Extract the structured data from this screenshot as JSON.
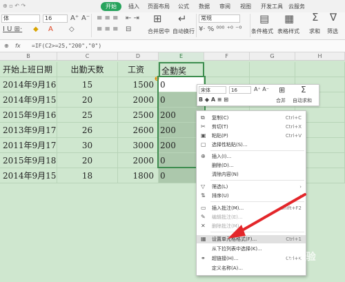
{
  "ribbon": {
    "tabs": [
      "开始",
      "插入",
      "页面布局",
      "公式",
      "数据",
      "审阅",
      "视图",
      "开发工具",
      "云服务"
    ],
    "font_name": "体",
    "font_size": "16",
    "number_format": "常规",
    "merge_center": "合并居中",
    "auto_wrap": "自动换行",
    "conditional_format": "条件格式",
    "table_style": "表格样式",
    "sum": "求和",
    "filter": "筛选"
  },
  "formula_bar": {
    "fx": "fx",
    "formula": "=IF(C2>=25,\"200\",\"0\")"
  },
  "columns": [
    "B",
    "C",
    "D",
    "E",
    "F",
    "G",
    "H"
  ],
  "table": {
    "headers": [
      "开始上班日期",
      "出勤天数",
      "工资",
      "全勤奖"
    ],
    "rows": [
      [
        "2014年9月16日",
        "15",
        "1500",
        "0"
      ],
      [
        "2014年9月15日",
        "20",
        "2000",
        "0"
      ],
      [
        "2015年9月16日",
        "25",
        "2500",
        "200"
      ],
      [
        "2013年9月17日",
        "26",
        "2600",
        "200"
      ],
      [
        "2011年9月17日",
        "30",
        "3000",
        "200"
      ],
      [
        "2015年9月18日",
        "20",
        "2000",
        "0"
      ],
      [
        "2014年9月15日",
        "18",
        "1800",
        "0"
      ]
    ]
  },
  "mini_toolbar": {
    "font": "宋体",
    "size": "16",
    "merge": "合并",
    "autosum": "自动求和"
  },
  "context_menu": {
    "items": [
      {
        "label": "复制(C)",
        "shortcut": "Ctrl+C",
        "icon": "copy-icon"
      },
      {
        "label": "剪切(T)",
        "shortcut": "Ctrl+X",
        "icon": "cut-icon"
      },
      {
        "label": "粘贴(P)",
        "shortcut": "Ctrl+V",
        "icon": "paste-icon"
      },
      {
        "label": "选择性粘贴(S)...",
        "shortcut": "",
        "icon": "paste-special-icon"
      },
      {
        "label": "插入(I)...",
        "shortcut": "",
        "icon": "insert-icon"
      },
      {
        "label": "删除(D)...",
        "shortcut": "",
        "icon": ""
      },
      {
        "label": "清除内容(N)",
        "shortcut": "",
        "icon": ""
      },
      {
        "label": "筛选(L)",
        "shortcut": "",
        "icon": "filter-icon"
      },
      {
        "label": "排序(U)",
        "shortcut": "",
        "icon": "sort-icon"
      },
      {
        "label": "插入批注(M)...",
        "shortcut": "Shift+F2",
        "icon": "comment-icon"
      },
      {
        "label": "编辑批注(E)...",
        "shortcut": "",
        "icon": "edit-comment-icon"
      },
      {
        "label": "删除批注(M)",
        "shortcut": "",
        "icon": "delete-comment-icon"
      },
      {
        "label": "设置单元格格式(F)...",
        "shortcut": "Ctrl+1",
        "icon": "format-cells-icon"
      },
      {
        "label": "从下拉列表中选择(K)...",
        "shortcut": "",
        "icon": ""
      },
      {
        "label": "超链接(H)...",
        "shortcut": "Ctrl+K",
        "icon": "link-icon"
      },
      {
        "label": "定义名称(A)...",
        "shortcut": "",
        "icon": ""
      }
    ]
  },
  "watermark": "Baidu 经验"
}
